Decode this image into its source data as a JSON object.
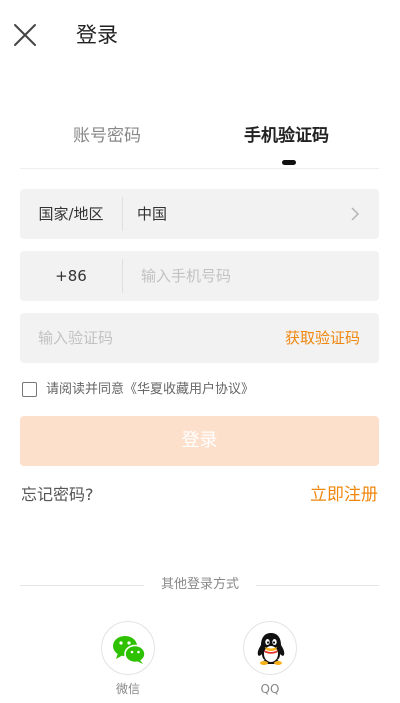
{
  "header": {
    "title": "登录"
  },
  "tabs": [
    {
      "label": "账号密码",
      "active": false
    },
    {
      "label": "手机验证码",
      "active": true
    }
  ],
  "form": {
    "country": {
      "label": "国家/地区",
      "value": "中国"
    },
    "phone": {
      "prefix": "+86",
      "value": "",
      "placeholder": "输入手机号码"
    },
    "code": {
      "value": "",
      "placeholder": "输入验证码",
      "get_code_label": "获取验证码"
    },
    "agreement": {
      "checked": false,
      "text": "请阅读并同意《华夏收藏用户协议》"
    },
    "login_label": "登录"
  },
  "links": {
    "forgot": "忘记密码?",
    "register": "立即注册"
  },
  "other_login": {
    "title": "其他登录方式",
    "options": [
      {
        "label": "微信",
        "icon": "wechat-icon"
      },
      {
        "label": "QQ",
        "icon": "qq-icon"
      }
    ]
  },
  "colors": {
    "accent": "#f0870f",
    "login_disabled_bg": "#fde0cc",
    "field_bg": "#f2f2f2",
    "wechat": "#2dc100"
  }
}
